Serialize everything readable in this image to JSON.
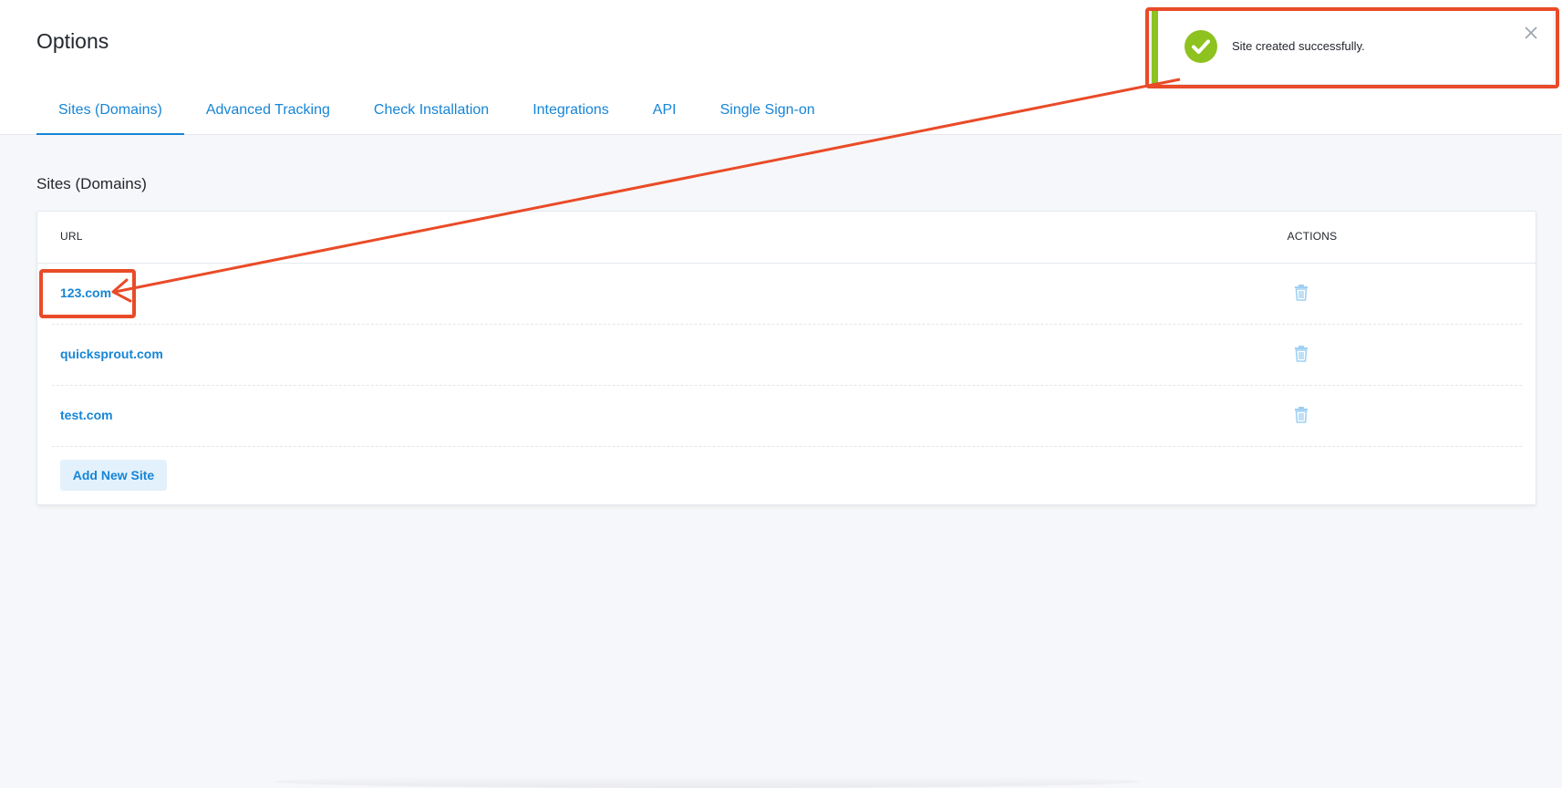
{
  "page": {
    "title": "Options"
  },
  "tabs": [
    {
      "label": "Sites (Domains)",
      "active": true
    },
    {
      "label": "Advanced Tracking"
    },
    {
      "label": "Check Installation"
    },
    {
      "label": "Integrations"
    },
    {
      "label": "API"
    },
    {
      "label": "Single Sign-on"
    }
  ],
  "section": {
    "title": "Sites (Domains)"
  },
  "table": {
    "columns": {
      "url": "URL",
      "actions": "ACTIONS"
    },
    "rows": [
      {
        "url": "123.com"
      },
      {
        "url": "quicksprout.com"
      },
      {
        "url": "test.com"
      }
    ],
    "action_icon": "trash-icon",
    "add_button": "Add New Site"
  },
  "toast": {
    "message": "Site created successfully.",
    "status_icon": "checkmark-circle-icon",
    "close_icon": "close-icon"
  },
  "colors": {
    "accent": "#1685d6",
    "success": "#8dc21f",
    "annotation": "#e94b28",
    "background": "#f6f7fa"
  }
}
